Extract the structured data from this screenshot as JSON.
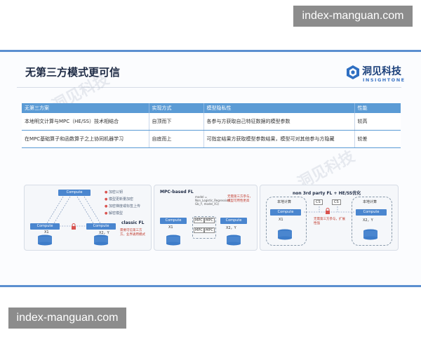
{
  "watermark": {
    "top_text": "index-manguan.com",
    "bottom_text": "index-manguan.com"
  },
  "slide": {
    "title": "无第三方模式更可信",
    "logo": {
      "cn": "洞见科技",
      "en": "INSIGHTONE"
    },
    "table": {
      "headers": [
        "无第三方案",
        "实现方式",
        "模型隐私性",
        "性能"
      ],
      "rows": [
        [
          "本地明文计算与MPC（HE/SS）技术相结合",
          "自顶而下",
          "各参与方获取自己特征数据的模型参数",
          "较高"
        ],
        [
          "在MPC基础算子和函数算子之上协同机器学习",
          "自底而上",
          "可指定结果方获取模型参数结果，模型可对其他参与方隐藏",
          "较差"
        ]
      ]
    },
    "panels": {
      "p1": {
        "top_box": "Compute",
        "left_box": "Compute",
        "right_box": "Compute",
        "left_label": "X1",
        "right_label": "X2，Y",
        "name": "classic FL",
        "legend": [
          "加密公钥",
          "模型更新量加密",
          "加密梯度或标签上传",
          "解密模型"
        ],
        "note": "需要可信第三方方，业界通用模式"
      },
      "p2": {
        "name": "MPC-based FL",
        "model_note": "model =\nNon_Logistic_Regression(\nGb_Y, model_X1)",
        "left_box": "Compute",
        "right_box": "Compute",
        "left_label": "X1",
        "right_label": "X2，Y",
        "mpc_boxes": [
          "MPC",
          "MPC",
          "MPC",
          "MPC"
        ],
        "note": "无需第三方参与，模型可用性更高"
      },
      "p3": {
        "name": "non 3rd party FL + HE/SS优化",
        "left_group": "本地计算",
        "right_group": "本地计算",
        "left_box": "Compute",
        "right_box": "Compute",
        "mid_boxes": [
          "CS",
          "CS"
        ],
        "left_label": "X1",
        "right_label": "X2，Y",
        "note": "无需第三方参与，扩展性强"
      }
    }
  }
}
